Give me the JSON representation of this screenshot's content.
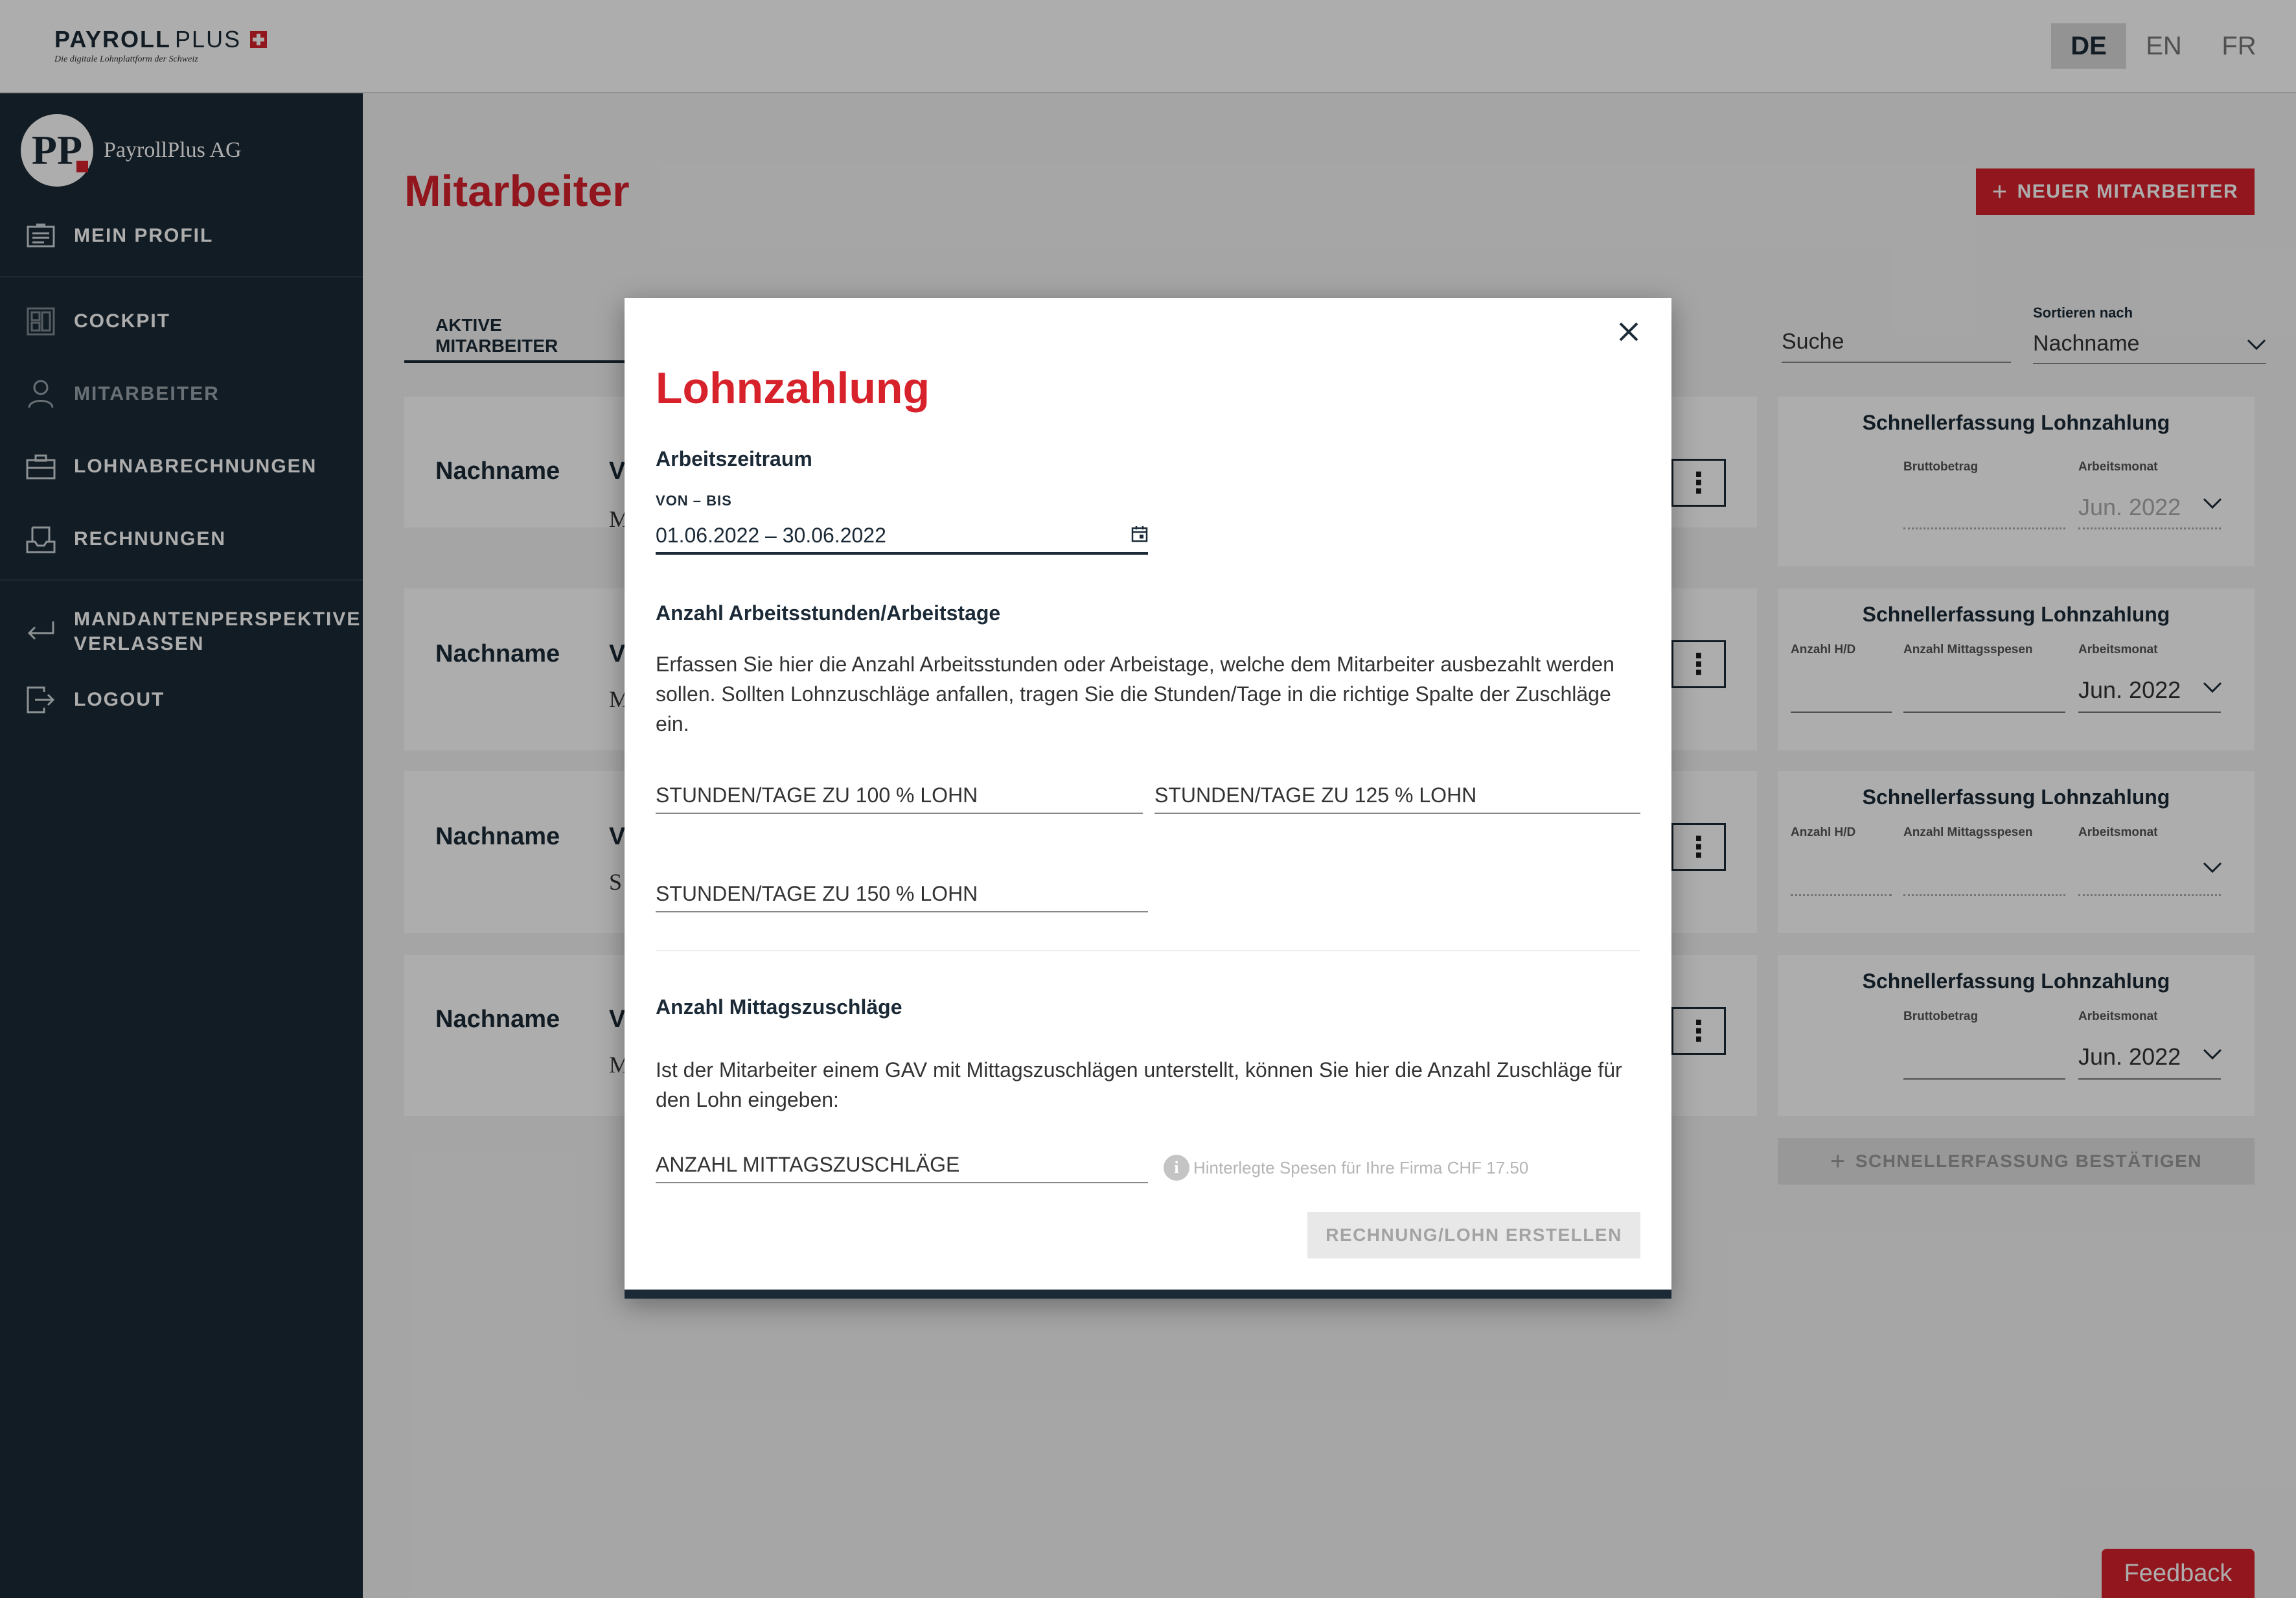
{
  "header": {
    "logo_bold": "PAYROLL",
    "logo_light": "PLUS",
    "logo_tagline": "Die digitale Lohnplattform der Schweiz",
    "languages": [
      "DE",
      "EN",
      "FR"
    ],
    "active_language": "DE"
  },
  "sidebar": {
    "avatar_initials": "PP",
    "company": "PayrollPlus AG",
    "items": [
      {
        "label": "MEIN PROFIL",
        "icon": "id-card-icon"
      },
      {
        "label": "COCKPIT",
        "icon": "dashboard-icon"
      },
      {
        "label": "MITARBEITER",
        "icon": "user-icon"
      },
      {
        "label": "LOHNABRECHNUNGEN",
        "icon": "briefcase-icon"
      },
      {
        "label": "RECHNUNGEN",
        "icon": "inbox-icon"
      },
      {
        "label_line1": "MANDANTENPERSPEKTIVE",
        "label_line2": "VERLASSEN",
        "icon": "return-arrow-icon"
      },
      {
        "label": "LOGOUT",
        "icon": "logout-icon"
      }
    ]
  },
  "main": {
    "title": "Mitarbeiter",
    "new_button": "NEUER MITARBEITER",
    "tab": "AKTIVE MITARBEITER",
    "search_placeholder": "Suche",
    "sort_label": "Sortieren nach",
    "sort_value": "Nachname",
    "employees": [
      {
        "last": "Nachname",
        "first_initial": "V",
        "sub_initial": "M"
      },
      {
        "last": "Nachname",
        "first_initial": "V",
        "sub_initial": "M"
      },
      {
        "last": "Nachname",
        "first_initial": "V",
        "sub_initial": "S"
      },
      {
        "last": "Nachname",
        "first_initial": "V",
        "sub_initial": "M"
      }
    ],
    "quick_entry": {
      "title": "Schnellerfassung Lohnzahlung",
      "label_brutto": "Bruttobetrag",
      "label_month": "Arbeitsmonat",
      "label_hd": "Anzahl H/D",
      "label_lunch": "Anzahl Mittagsspesen",
      "month_value": "Jun. 2022",
      "confirm_button": "SCHNELLERFASSUNG BESTÄTIGEN"
    },
    "feedback": "Feedback"
  },
  "modal": {
    "title": "Lohnzahlung",
    "period_section": "Arbeitszeitraum",
    "period_label": "VON – BIS",
    "period_value": "01.06.2022 – 30.06.2022",
    "hours_section": "Anzahl Arbeitsstunden/Arbeitstage",
    "hours_text": "Erfassen Sie hier die Anzahl Arbeitsstunden oder Arbeistage, welche dem Mitarbeiter ausbezahlt werden sollen. Sollten Lohnzuschläge anfallen, tragen Sie die Stunden/Tage in die richtige Spalte der Zuschläge ein.",
    "field_100": "STUNDEN/TAGE ZU 100 % LOHN",
    "field_125": "STUNDEN/TAGE ZU 125 % LOHN",
    "field_150": "STUNDEN/TAGE ZU 150 % LOHN",
    "lunch_section": "Anzahl Mittagszuschläge",
    "lunch_text": "Ist der Mitarbeiter einem GAV mit Mittagszuschlägen unterstellt, können Sie hier die Anzahl Zuschläge für den Lohn eingeben:",
    "lunch_field": "ANZAHL MITTAGSZUSCHLÄGE",
    "hint_icon": "i",
    "hint": "Hinterlegte Spesen für Ihre Firma CHF 17.50",
    "submit": "RECHNUNG/LOHN ERSTELLEN"
  },
  "colors": {
    "accent": "#d7212b",
    "navy": "#1b2a36"
  }
}
